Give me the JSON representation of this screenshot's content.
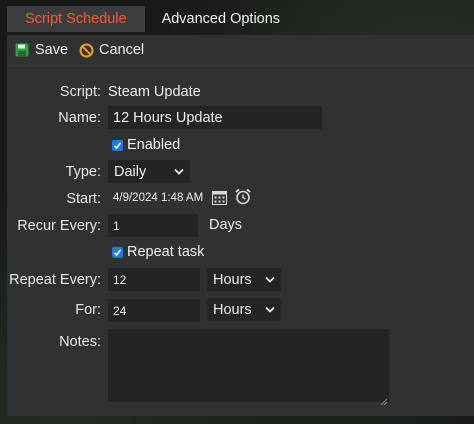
{
  "tabs": [
    {
      "label": "Script Schedule",
      "active": true
    },
    {
      "label": "Advanced Options",
      "active": false
    }
  ],
  "toolbar": {
    "save_label": "Save",
    "cancel_label": "Cancel"
  },
  "form": {
    "script": {
      "label": "Script:",
      "value": "Steam Update"
    },
    "name": {
      "label": "Name:",
      "value": "12 Hours Update"
    },
    "enabled": {
      "label": "Enabled",
      "checked": true
    },
    "type": {
      "label": "Type:",
      "value": "Daily"
    },
    "start": {
      "label": "Start:",
      "value": "4/9/2024 1:48 AM"
    },
    "recur": {
      "label": "Recur Every:",
      "value": "1",
      "unit": "Days"
    },
    "repeat_task": {
      "label": "Repeat task",
      "checked": true
    },
    "repeat_every": {
      "label": "Repeat Every:",
      "value": "12",
      "unit": "Hours"
    },
    "for": {
      "label": "For:",
      "value": "24",
      "unit": "Hours"
    },
    "notes": {
      "label": "Notes:",
      "value": ""
    }
  },
  "colors": {
    "accent": "#ff5a36",
    "panel": "#2f3133",
    "field": "#222426",
    "checkbox": "#1f7ae0",
    "save_icon": "#2ea043",
    "cancel_icon": "#f0a020"
  },
  "icons": {
    "save": "floppy-disk-icon",
    "cancel": "no-entry-icon",
    "calendar": "calendar-icon",
    "clock": "alarm-clock-icon",
    "chevron": "chevron-down-icon",
    "check": "checkmark-icon"
  }
}
